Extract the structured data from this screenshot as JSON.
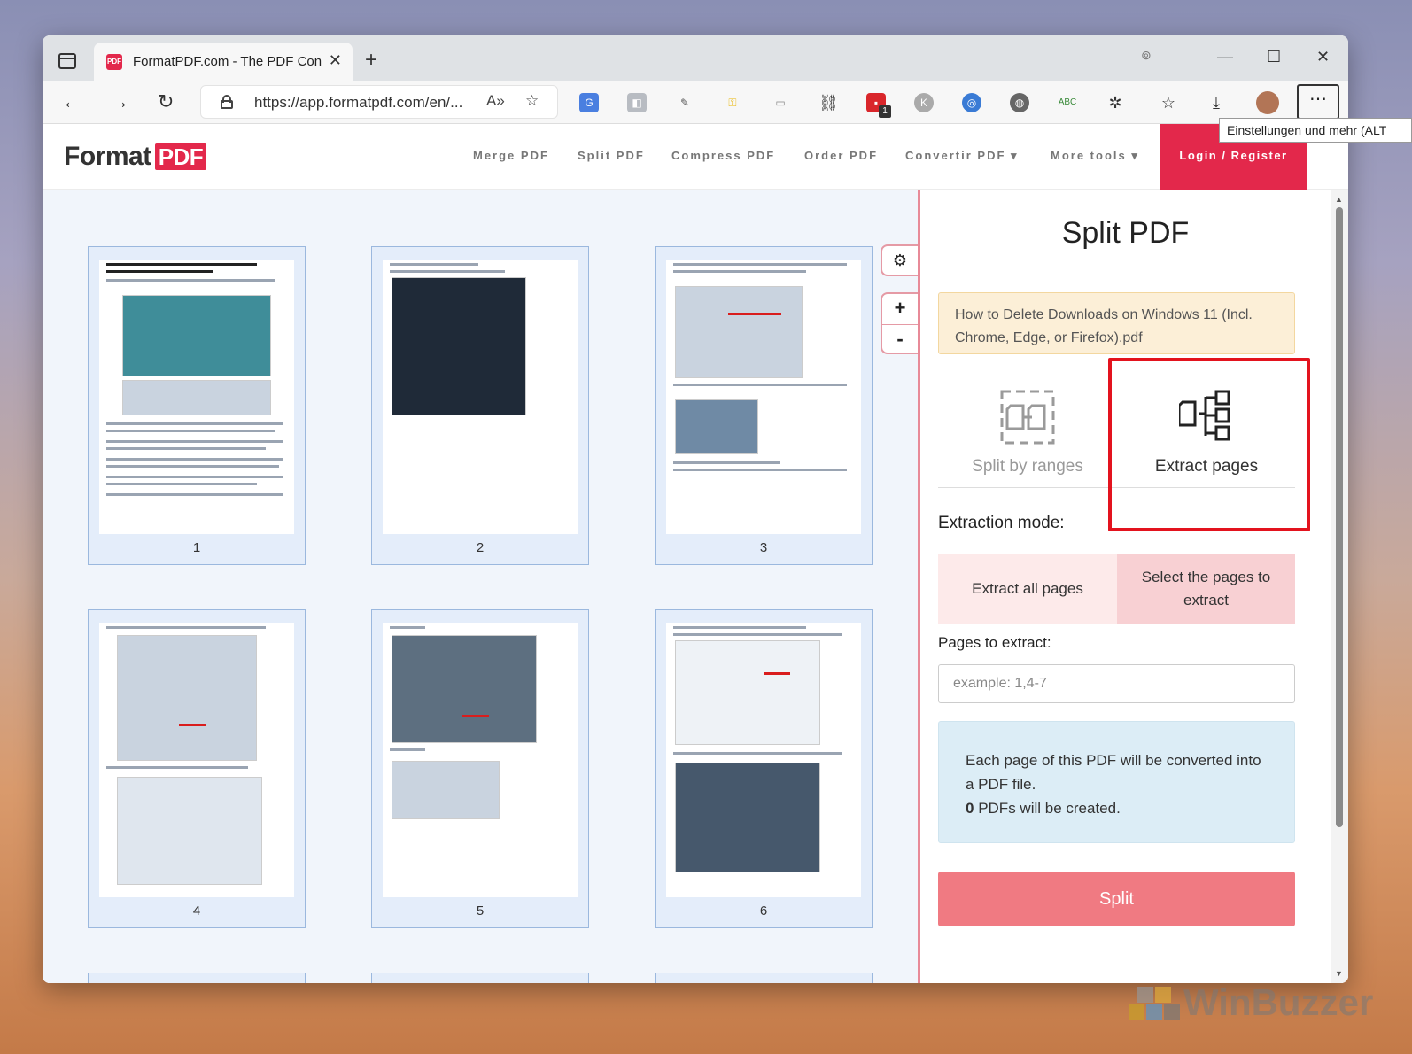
{
  "browser": {
    "tab_title": "FormatPDF.com - The PDF Conve",
    "favicon_text": "PDF",
    "url": "https://app.formatpdf.com/en/...",
    "read_aloud": "A»",
    "tooltip": "Einstellungen und mehr (ALT",
    "more_label": "⋯",
    "ext_badge": "1"
  },
  "site": {
    "logo_text": "Format",
    "logo_pdf": "PDF",
    "nav": [
      "Merge PDF",
      "Split PDF",
      "Compress PDF",
      "Order PDF",
      "Convertir PDF",
      "More tools"
    ],
    "login": "Login / Register"
  },
  "viewer": {
    "pages": [
      "1",
      "2",
      "3",
      "4",
      "5",
      "6"
    ]
  },
  "panel": {
    "title": "Split PDF",
    "filename": "How to Delete Downloads on Windows 11 (Incl. Chrome, Edge, or Firefox).pdf",
    "modes": {
      "ranges": "Split by ranges",
      "extract": "Extract pages"
    },
    "extraction_mode_label": "Extraction mode:",
    "extract_all": "Extract all pages",
    "select_pages": "Select the pages to extract",
    "pages_label": "Pages to extract:",
    "pages_placeholder": "example: 1,4-7",
    "info_line1": "Each page of this PDF will be converted into a PDF file.",
    "info_count": "0",
    "info_line2": " PDFs will be created.",
    "split_button": "Split"
  },
  "watermark": "WinBuzzer",
  "colors": {
    "brand": "#e3284b",
    "split_button": "#f07a82",
    "highlight": "#e3131e",
    "info_bg": "#dcedf6",
    "file_bg": "#fcefd7"
  }
}
